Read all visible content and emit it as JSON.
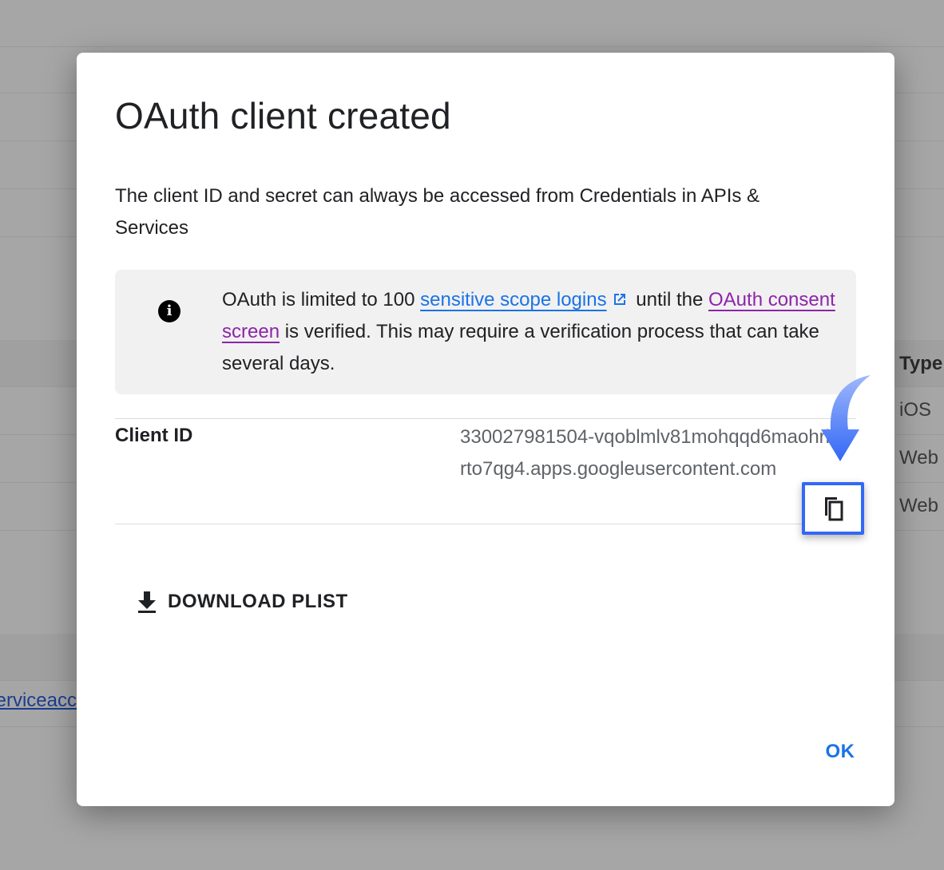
{
  "background": {
    "type_column": {
      "header": "Type",
      "values": [
        "iOS",
        "Web",
        "Web"
      ]
    },
    "service_account_link": "serviceacc"
  },
  "dialog": {
    "title": "OAuth client created",
    "description": "The client ID and secret can always be accessed from Credentials in APIs & Services",
    "info": {
      "text_before_link1": "OAuth is limited to 100 ",
      "link1": "sensitive scope logins",
      "text_between_links": " until the ",
      "link2": "OAuth consent screen",
      "text_after_link2": " is verified. This may require a verification process that can take several days."
    },
    "client_id": {
      "label": "Client ID",
      "value": "330027981504-vqoblmlv81mohqqd6maohri00rto7qg4.apps.googleusercontent.com"
    },
    "download_label": "DOWNLOAD PLIST",
    "ok_label": "OK"
  },
  "colors": {
    "link_blue": "#1a73e8",
    "link_visited": "#8e24aa",
    "highlight": "#3367f6",
    "overlay": "#a6a6a6"
  },
  "icons": {
    "info": "info-icon",
    "external_link": "external-link-icon",
    "copy": "copy-icon",
    "download": "download-icon",
    "annotation_arrow": "curved-arrow-icon"
  }
}
